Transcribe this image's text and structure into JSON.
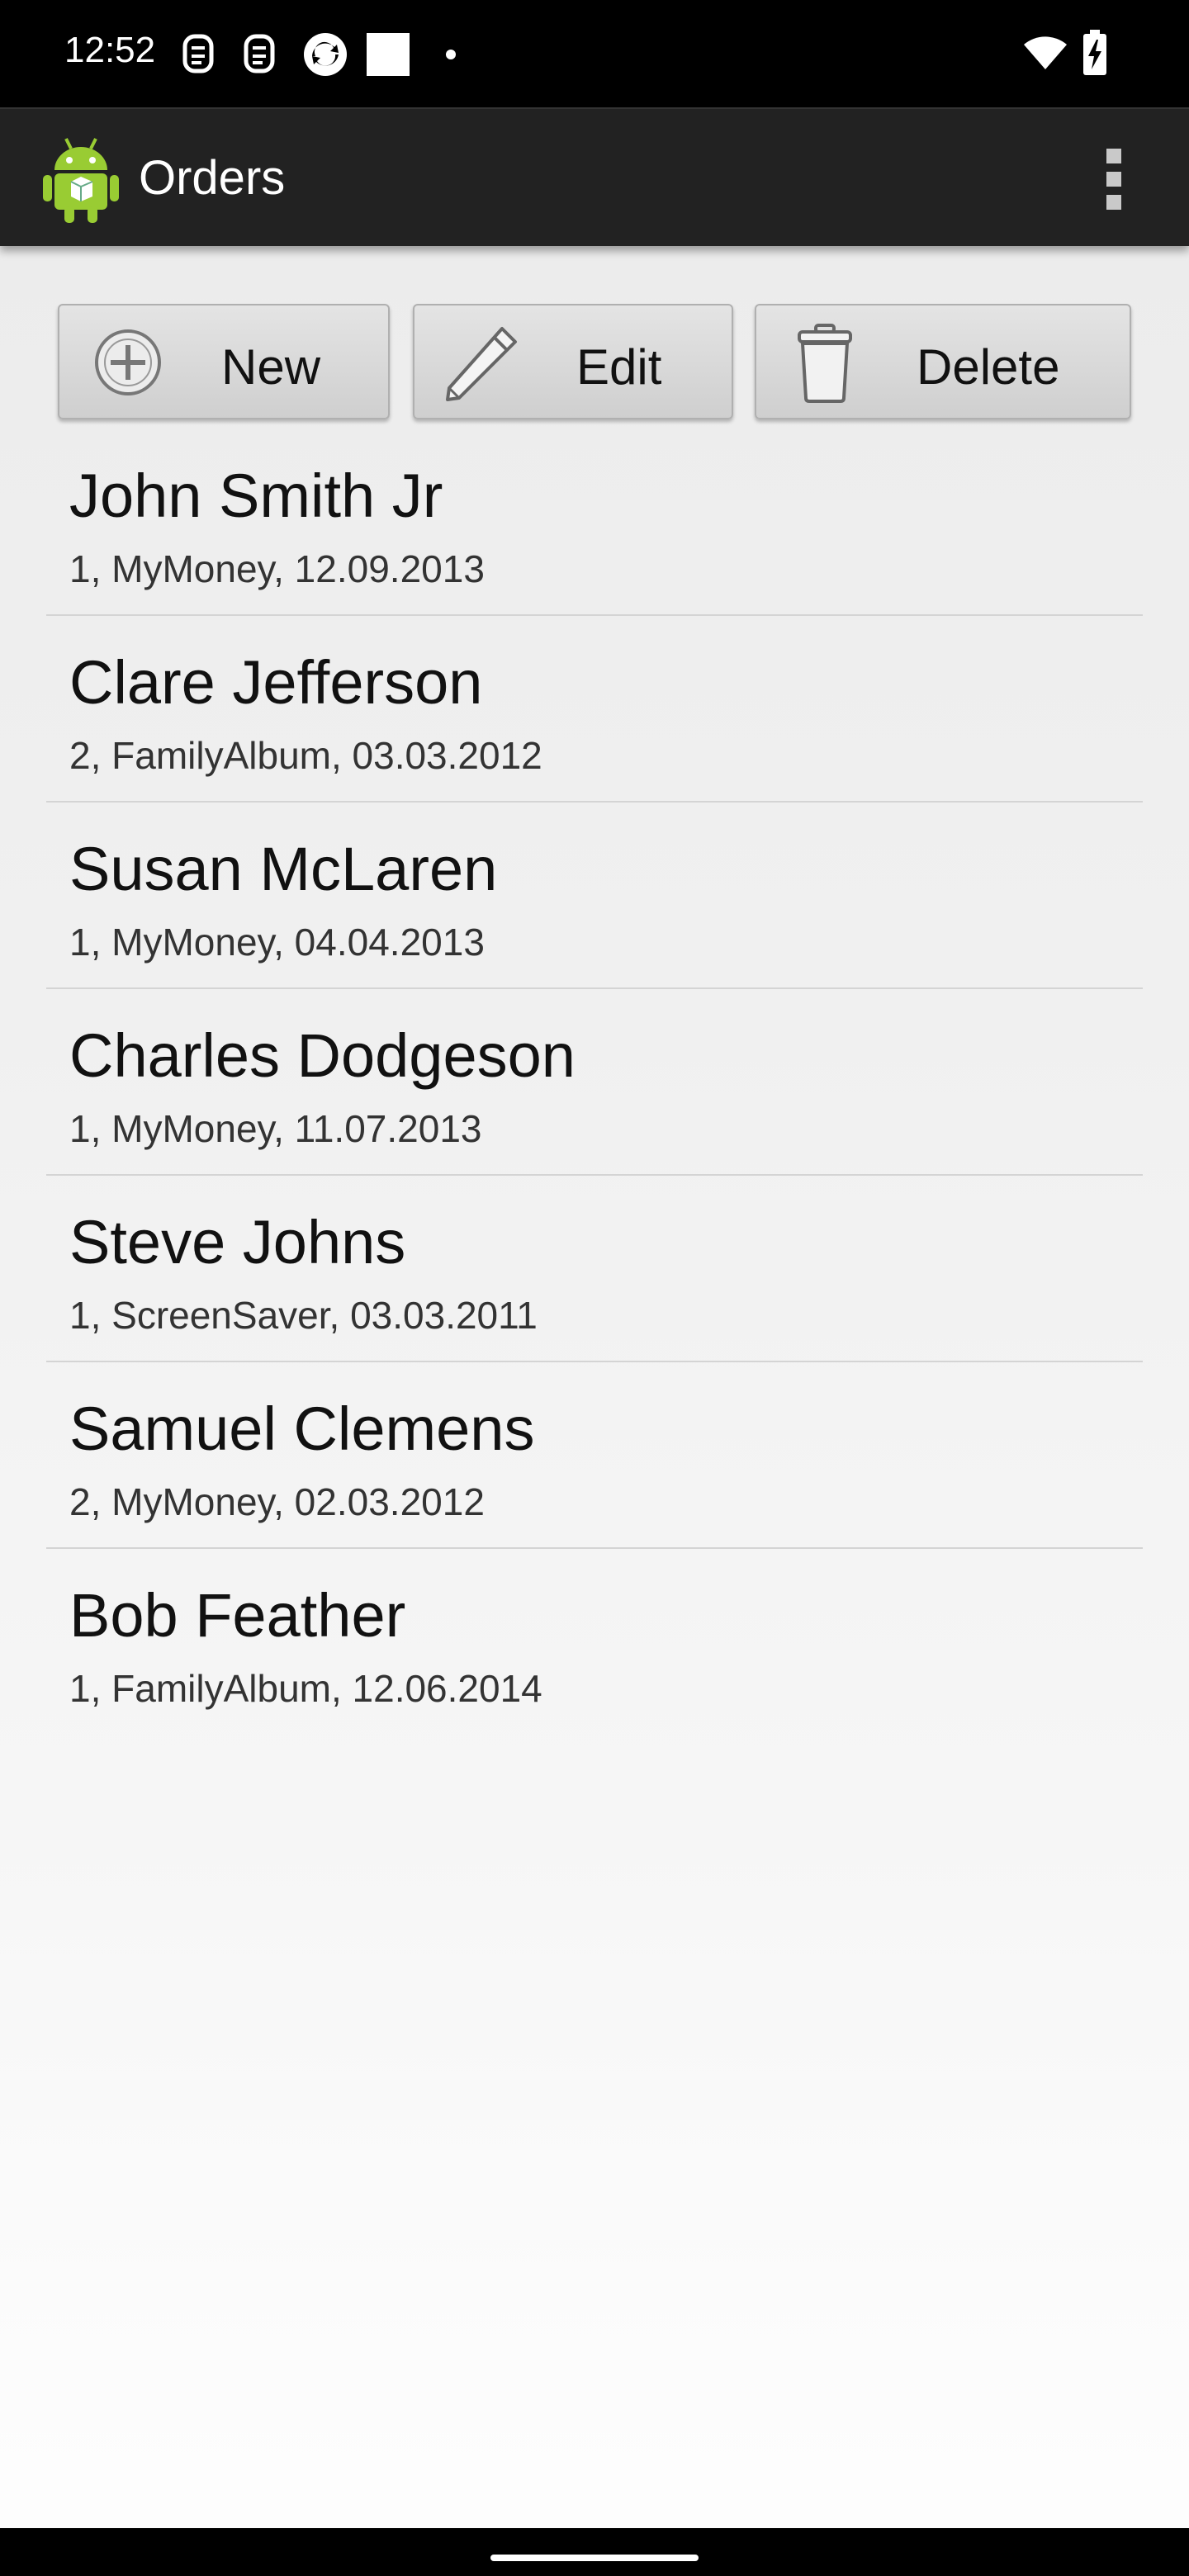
{
  "status_bar": {
    "time": "12:52",
    "icons": [
      "notification-s-icon",
      "notification-s-icon",
      "sync-icon",
      "square-icon",
      "dot-icon",
      "wifi-icon",
      "battery-charging-icon"
    ]
  },
  "action_bar": {
    "title": "Orders",
    "app_icon": "android-app-icon",
    "menu_icon": "overflow-menu-icon"
  },
  "toolbar": {
    "new_label": "New",
    "edit_label": "Edit",
    "delete_label": "Delete"
  },
  "orders": [
    {
      "name": "John Smith Jr",
      "detail": "1, MyMoney, 12.09.2013"
    },
    {
      "name": "Clare Jefferson",
      "detail": "2, FamilyAlbum, 03.03.2012"
    },
    {
      "name": "Susan McLaren",
      "detail": "1, MyMoney, 04.04.2013"
    },
    {
      "name": "Charles Dodgeson",
      "detail": "1, MyMoney, 11.07.2013"
    },
    {
      "name": "Steve Johns",
      "detail": "1, ScreenSaver, 03.03.2011"
    },
    {
      "name": "Samuel Clemens",
      "detail": "2, MyMoney, 02.03.2012"
    },
    {
      "name": "Bob Feather",
      "detail": "1, FamilyAlbum, 12.06.2014"
    }
  ]
}
